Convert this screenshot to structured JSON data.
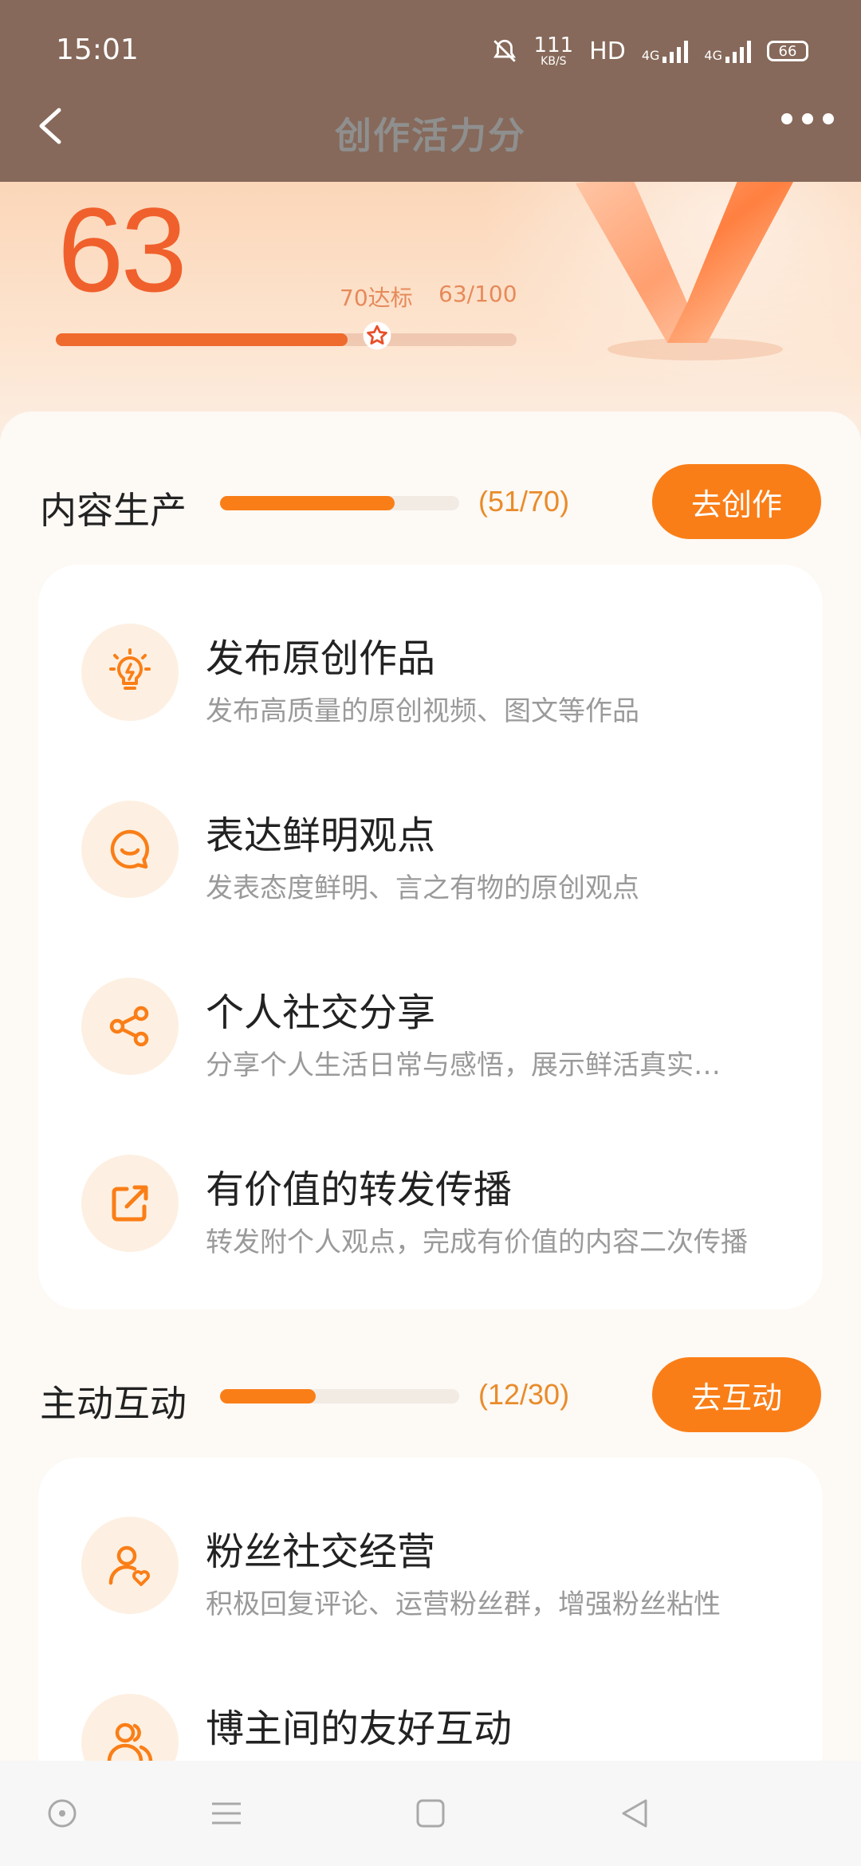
{
  "status_bar": {
    "time": "15:01",
    "net_speed": "111",
    "net_unit": "KB/S",
    "hd": "HD",
    "sig1": "4G",
    "sig2": "4G",
    "battery": "66"
  },
  "nav": {
    "title": "创作活力分"
  },
  "score": {
    "value": "63",
    "target_label": "70达标",
    "ratio": "63/100",
    "progress_fraction": 0.63,
    "target_fraction": 0.7
  },
  "sections": [
    {
      "title": "内容生产",
      "count": "(51/70)",
      "progress_fraction": 0.7286,
      "button": "去创作",
      "items": [
        {
          "title": "发布原创作品",
          "desc": "发布高质量的原创视频、图文等作品",
          "icon": "lightbulb-icon"
        },
        {
          "title": "表达鲜明观点",
          "desc": "发表态度鲜明、言之有物的原创观点",
          "icon": "smile-chat-icon"
        },
        {
          "title": "个人社交分享",
          "desc": "分享个人生活日常与感悟，展示鲜活真实…",
          "icon": "share-icon"
        },
        {
          "title": "有价值的转发传播",
          "desc": "转发附个人观点，完成有价值的内容二次传播",
          "icon": "forward-icon"
        }
      ]
    },
    {
      "title": "主动互动",
      "count": "(12/30)",
      "progress_fraction": 0.4,
      "button": "去互动",
      "items": [
        {
          "title": "粉丝社交经营",
          "desc": "积极回复评论、运营粉丝群，增强粉丝粘性",
          "icon": "user-heart-icon"
        },
        {
          "title": "博主间的友好互动",
          "desc": "",
          "icon": "users-icon"
        }
      ]
    }
  ],
  "colors": {
    "accent": "#fa7e17",
    "score": "#f0602c"
  }
}
